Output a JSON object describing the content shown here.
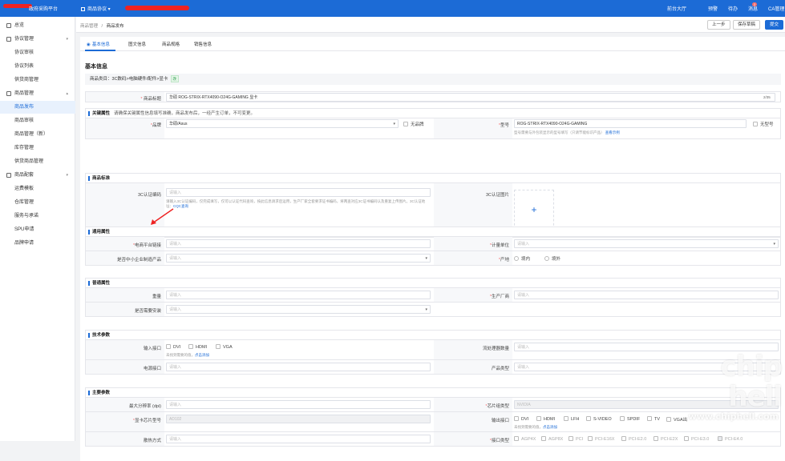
{
  "topbar": {
    "logo": "政府采购平台",
    "module": "商品协议 ▾",
    "nav": [
      "前台大厅",
      "预警",
      "待办",
      "消息",
      "CA管理"
    ],
    "badge": "2"
  },
  "sidebar": {
    "items": [
      {
        "label": "总览",
        "icon": "home-icon",
        "group": true
      },
      {
        "label": "协议管理",
        "icon": "folder-icon",
        "group": true,
        "arrow": "▾"
      },
      {
        "label": "协议审核"
      },
      {
        "label": "协议列表"
      },
      {
        "label": "供货商管理"
      },
      {
        "label": "商品管理",
        "icon": "folder-icon",
        "group": true,
        "arrow": "▴"
      },
      {
        "label": "商品发布",
        "active": true
      },
      {
        "label": "商品审核"
      },
      {
        "label": "商品管理（新）"
      },
      {
        "label": "库存管理"
      },
      {
        "label": "供货商品管理"
      },
      {
        "label": "商品配套",
        "icon": "folder-icon",
        "group": true,
        "arrow": "▾"
      },
      {
        "label": "运费模板"
      },
      {
        "label": "仓库管理"
      },
      {
        "label": "服务与承诺"
      },
      {
        "label": "SPU申请"
      },
      {
        "label": "品牌申请"
      }
    ]
  },
  "breadcrumb": {
    "parent": "商品管理",
    "sep": "/",
    "current": "商品发布"
  },
  "actions": {
    "prev": "上一步",
    "save": "保存草稿",
    "submit": "提交"
  },
  "tabs": [
    "基本信息",
    "图文信息",
    "商品规格",
    "销售信息"
  ],
  "basic": {
    "title": "基本信息",
    "category_label": "商品类目：",
    "category": "3C数码>电脑硬件/配件>显卡",
    "category_tag": "改",
    "product_title_label": "商品标题",
    "product_title": "华硕 ROG-STRIX-RTX4090-O24G-GAMING  显卡",
    "title_count": "2/35"
  },
  "key_attrs": {
    "head": "关键属性",
    "note": "请确保关键属性信息填写准确，商品发布后，一经产生订单，不可变更。",
    "brand_label": "品牌",
    "brand": "华硕/Asus",
    "no_brand": "无品牌",
    "model_label": "型号",
    "model": "ROG-STRIX-RTX4090-O24G-GAMING",
    "no_model": "无型号",
    "model_hint": "型号需要与外包装显示的型号填写（只请节能标识产品）",
    "model_link": "查看示例"
  },
  "cert": {
    "head": "商品标准",
    "code_label": "3C认证编码",
    "code_ph": "请输入",
    "code_hint": "请输入3C认证编码，仅完成填写，仅可以认证代码查询，按此信息请求后运用，生产厂家全套要求证书编码，将两查对应3C证书编码认及重复上传图片。3C认证地址：",
    "code_link": "CQC查询",
    "img_label": "3C认证图片",
    "plus": "+"
  },
  "general": {
    "head": "通用属性",
    "link_label": "电商平台链接",
    "link_ph": "请输入",
    "unit_label": "计量单位",
    "unit_ph": "请输入",
    "sme_label": "是否中小企业制造产品",
    "sme_ph": "请输入",
    "origin_label": "产地",
    "origin_options": [
      "境内",
      "境外"
    ]
  },
  "ordinary": {
    "head": "普通属性",
    "weight_label": "重量",
    "weight_ph": "请输入",
    "maker_label": "生产厂商",
    "maker_ph": "请输入",
    "install_label": "是否需要安装",
    "install_ph": "请输入"
  },
  "tech": {
    "head": "技术参数",
    "input_label": "输入接口",
    "input_options": [
      "DVI",
      "HDMI",
      "VGA"
    ],
    "input_hint": "未找到需要的值，",
    "input_link": "点击添加",
    "stream_label": "流处理器数量",
    "stream_ph": "请输入",
    "power_label": "电源接口",
    "power_ph": "请输入",
    "type_label": "产品类型",
    "type_ph": "请输入"
  },
  "main_params": {
    "head": "主要参数",
    "res_label": "最大分辨率 (dpi)",
    "res_ph": "请输入",
    "chip_label": "芯片组类型",
    "chip_val": "NVIDIA",
    "gpu_label": "显卡芯片型号",
    "gpu_val": "AD102",
    "out_label": "输出接口",
    "out_options": [
      "DVI",
      "HDMI",
      "LFH",
      "S-VIDEO",
      "SPDIF",
      "TV",
      "VGA出"
    ],
    "out_hint": "未找到需要的值，",
    "out_link": "点击添加",
    "cool_label": "散热方式",
    "cool_ph": "请输入",
    "iface_label": "接口类型",
    "iface_options": [
      "AGP4X",
      "AGP8X",
      "PCI",
      "PCI-E16X",
      "PCI-E2.0",
      "PCI-E2X",
      "PCI-E3.0",
      "PCI-E4.0"
    ]
  },
  "watermark": {
    "text": "www.chiphell.com",
    "logo": "chip hell"
  },
  "colors": {
    "primary": "#1c6bd6",
    "required": "#f56c6c"
  }
}
